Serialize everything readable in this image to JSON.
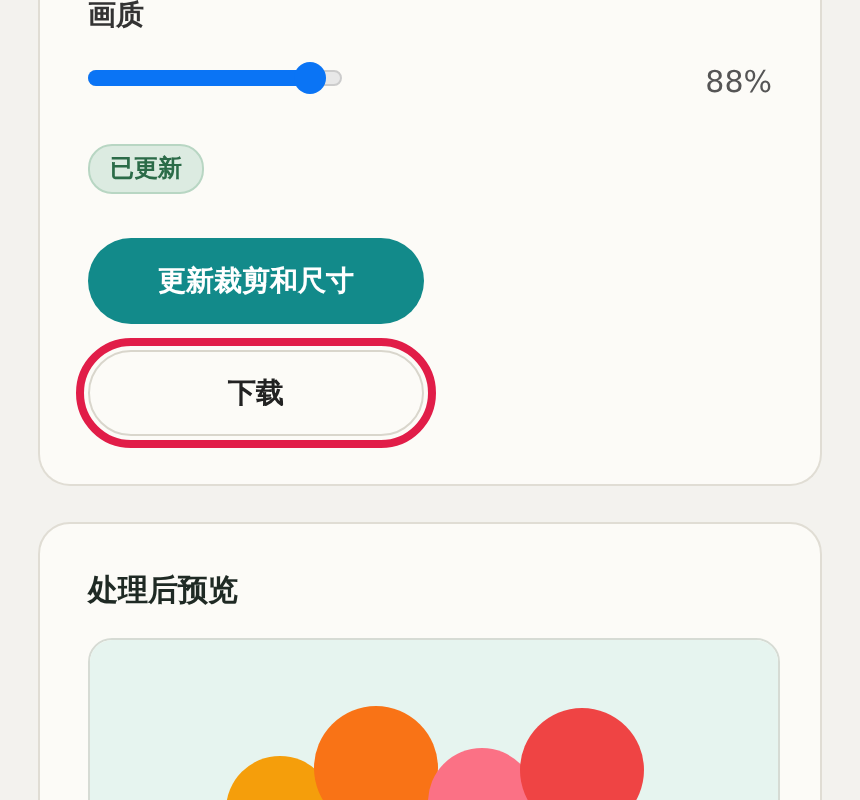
{
  "quality": {
    "label": "画质",
    "level": 0.88,
    "reading": "88%"
  },
  "status_badge": "已更新",
  "buttons": [
    {
      "label": "更新裁剪和尺寸",
      "kind": "primary",
      "highlighted": false
    },
    {
      "label": "下载",
      "kind": "secondary",
      "highlighted": true
    }
  ],
  "preview": {
    "title": "处理后预览"
  }
}
